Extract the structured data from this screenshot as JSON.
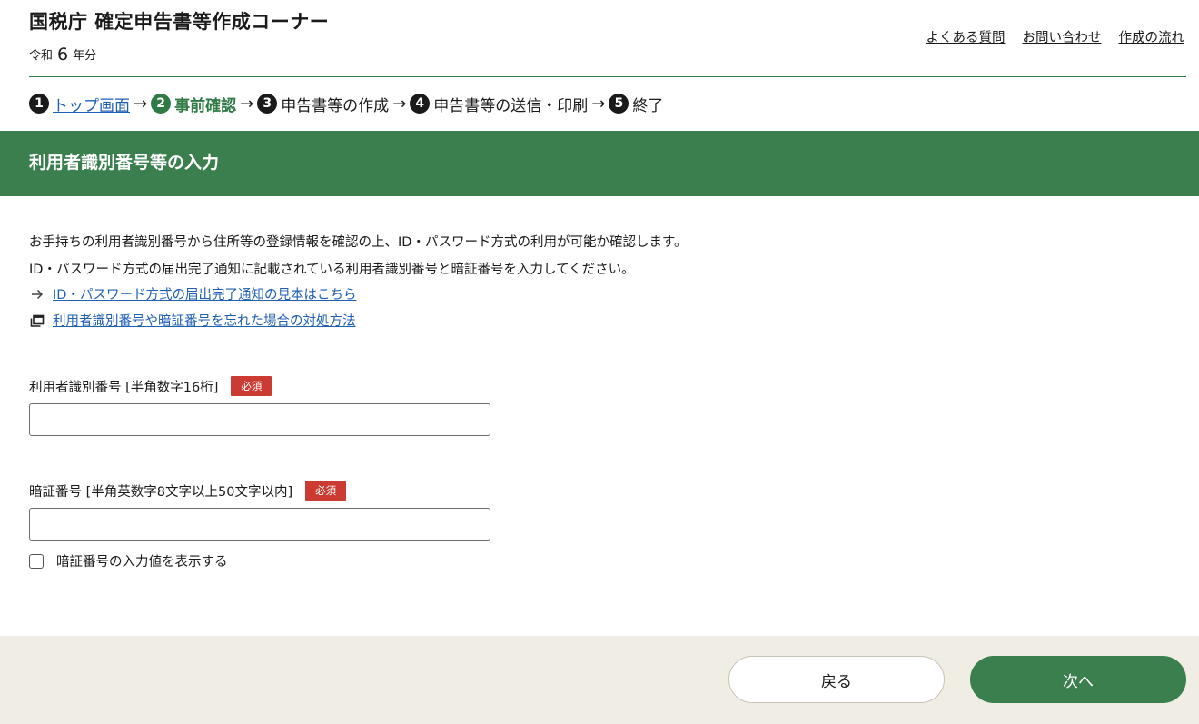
{
  "header": {
    "title": "国税庁 確定申告書等作成コーナー",
    "year_prefix": "令和",
    "year_number": "6",
    "year_suffix": "年分",
    "links": [
      "よくある質問",
      "お問い合わせ",
      "作成の流れ"
    ]
  },
  "steps": [
    {
      "num": "1",
      "label": "トップ画面"
    },
    {
      "num": "2",
      "label": "事前確認"
    },
    {
      "num": "3",
      "label": "申告書等の作成"
    },
    {
      "num": "4",
      "label": "申告書等の送信・印刷"
    },
    {
      "num": "5",
      "label": "終了"
    }
  ],
  "current_step": 2,
  "section": {
    "title": "利用者識別番号等の入力"
  },
  "description": [
    "お手持ちの利用者識別番号から住所等の登録情報を確認の上、ID・パスワード方式の利用が可能か確認します。",
    "ID・パスワード方式の届出完了通知に記載されている利用者識別番号と暗証番号を入力してください。"
  ],
  "links": [
    {
      "icon": "arrow-right-icon",
      "label": "ID・パスワード方式の届出完了通知の見本はこちら"
    },
    {
      "icon": "new-window-icon",
      "label": "利用者識別番号や暗証番号を忘れた場合の対処方法"
    }
  ],
  "form": {
    "user_id": {
      "label": "利用者識別番号 [半角数字16桁]",
      "required": "必須",
      "value": ""
    },
    "password": {
      "label": "暗証番号 [半角英数字8文字以上50文字以内]",
      "required": "必須",
      "value": ""
    },
    "show_password": {
      "label": "暗証番号の入力値を表示する",
      "checked": false
    }
  },
  "buttons": {
    "back": "戻る",
    "next": "次へ"
  },
  "colors": {
    "primary_green": "#3b7f4e",
    "required_red": "#cc3b32",
    "link_blue": "#1f5fb4",
    "footer_bg": "#f0ede5"
  }
}
